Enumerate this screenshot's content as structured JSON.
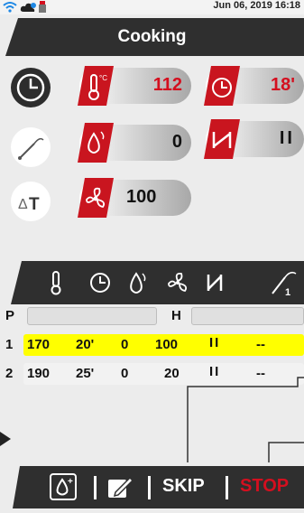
{
  "status_bar": {
    "datetime": "Jun 06, 2019 16:18",
    "icons": [
      "wifi-icon",
      "cloud-icon",
      "usb-icon"
    ]
  },
  "header": {
    "title": "Cooking"
  },
  "params": {
    "temperature": {
      "value": "112",
      "unit": "°C"
    },
    "time": {
      "value": "18'"
    },
    "humidity": {
      "value": "0"
    },
    "damper": {
      "value": "II"
    },
    "fan": {
      "value": "100"
    }
  },
  "steps": {
    "columns": [
      "thermometer-icon",
      "clock-icon",
      "humidity-icon",
      "fan-icon",
      "damper-icon",
      "probe-icon"
    ],
    "p_label": "P",
    "h_label": "H",
    "rows": [
      {
        "num": "1",
        "temp": "170",
        "time": "20'",
        "humidity": "0",
        "fan": "100",
        "damper": "II",
        "probe": "--"
      },
      {
        "num": "2",
        "temp": "190",
        "time": "25'",
        "humidity": "0",
        "fan": "20",
        "damper": "II",
        "probe": "--"
      }
    ]
  },
  "bottom": {
    "skip_label": "SKIP",
    "stop_label": "STOP"
  },
  "colors": {
    "accent": "#d40f1f",
    "highlight": "#ffff00",
    "dark": "#2d2d2d"
  }
}
